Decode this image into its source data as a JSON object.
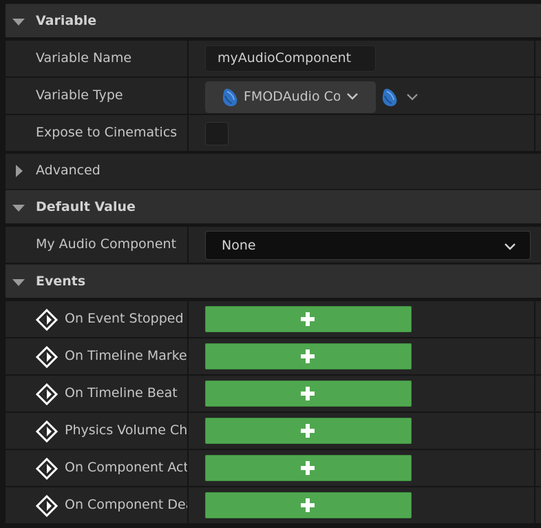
{
  "sections": {
    "variable": "Variable",
    "advanced": "Advanced",
    "default_value": "Default Value",
    "events": "Events"
  },
  "variable": {
    "name_label": "Variable Name",
    "name_value": "myAudioComponent",
    "type_label": "Variable Type",
    "type_value": "FMODAudio Component",
    "expose_label": "Expose to Cinematics"
  },
  "default_value": {
    "label": "My Audio Component",
    "value": "None"
  },
  "events": {
    "items": [
      {
        "label": "On Event Stopped"
      },
      {
        "label": "On Timeline Marker"
      },
      {
        "label": "On Timeline Beat"
      },
      {
        "label": "Physics Volume Changed"
      },
      {
        "label": "On Component Activated"
      },
      {
        "label": "On Component Deactivated"
      }
    ]
  },
  "colors": {
    "add_button": "#4fa84f",
    "type_icon": "#2f72c4"
  },
  "icons": {
    "collapse": "triangle-down-icon",
    "expand": "triangle-right-icon",
    "type": "fmod-blob-icon",
    "event_pin": "event-diamond-icon",
    "add": "plus-icon",
    "dropdown": "chevron-down-icon"
  }
}
